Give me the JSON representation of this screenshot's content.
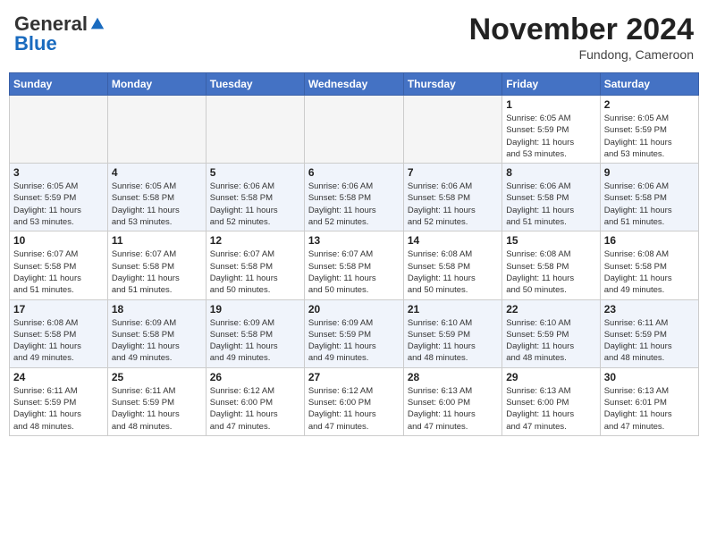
{
  "header": {
    "logo_general": "General",
    "logo_blue": "Blue",
    "month_title": "November 2024",
    "location": "Fundong, Cameroon"
  },
  "weekdays": [
    "Sunday",
    "Monday",
    "Tuesday",
    "Wednesday",
    "Thursday",
    "Friday",
    "Saturday"
  ],
  "weeks": [
    [
      {
        "day": "",
        "info": ""
      },
      {
        "day": "",
        "info": ""
      },
      {
        "day": "",
        "info": ""
      },
      {
        "day": "",
        "info": ""
      },
      {
        "day": "",
        "info": ""
      },
      {
        "day": "1",
        "info": "Sunrise: 6:05 AM\nSunset: 5:59 PM\nDaylight: 11 hours\nand 53 minutes."
      },
      {
        "day": "2",
        "info": "Sunrise: 6:05 AM\nSunset: 5:59 PM\nDaylight: 11 hours\nand 53 minutes."
      }
    ],
    [
      {
        "day": "3",
        "info": "Sunrise: 6:05 AM\nSunset: 5:59 PM\nDaylight: 11 hours\nand 53 minutes."
      },
      {
        "day": "4",
        "info": "Sunrise: 6:05 AM\nSunset: 5:58 PM\nDaylight: 11 hours\nand 53 minutes."
      },
      {
        "day": "5",
        "info": "Sunrise: 6:06 AM\nSunset: 5:58 PM\nDaylight: 11 hours\nand 52 minutes."
      },
      {
        "day": "6",
        "info": "Sunrise: 6:06 AM\nSunset: 5:58 PM\nDaylight: 11 hours\nand 52 minutes."
      },
      {
        "day": "7",
        "info": "Sunrise: 6:06 AM\nSunset: 5:58 PM\nDaylight: 11 hours\nand 52 minutes."
      },
      {
        "day": "8",
        "info": "Sunrise: 6:06 AM\nSunset: 5:58 PM\nDaylight: 11 hours\nand 51 minutes."
      },
      {
        "day": "9",
        "info": "Sunrise: 6:06 AM\nSunset: 5:58 PM\nDaylight: 11 hours\nand 51 minutes."
      }
    ],
    [
      {
        "day": "10",
        "info": "Sunrise: 6:07 AM\nSunset: 5:58 PM\nDaylight: 11 hours\nand 51 minutes."
      },
      {
        "day": "11",
        "info": "Sunrise: 6:07 AM\nSunset: 5:58 PM\nDaylight: 11 hours\nand 51 minutes."
      },
      {
        "day": "12",
        "info": "Sunrise: 6:07 AM\nSunset: 5:58 PM\nDaylight: 11 hours\nand 50 minutes."
      },
      {
        "day": "13",
        "info": "Sunrise: 6:07 AM\nSunset: 5:58 PM\nDaylight: 11 hours\nand 50 minutes."
      },
      {
        "day": "14",
        "info": "Sunrise: 6:08 AM\nSunset: 5:58 PM\nDaylight: 11 hours\nand 50 minutes."
      },
      {
        "day": "15",
        "info": "Sunrise: 6:08 AM\nSunset: 5:58 PM\nDaylight: 11 hours\nand 50 minutes."
      },
      {
        "day": "16",
        "info": "Sunrise: 6:08 AM\nSunset: 5:58 PM\nDaylight: 11 hours\nand 49 minutes."
      }
    ],
    [
      {
        "day": "17",
        "info": "Sunrise: 6:08 AM\nSunset: 5:58 PM\nDaylight: 11 hours\nand 49 minutes."
      },
      {
        "day": "18",
        "info": "Sunrise: 6:09 AM\nSunset: 5:58 PM\nDaylight: 11 hours\nand 49 minutes."
      },
      {
        "day": "19",
        "info": "Sunrise: 6:09 AM\nSunset: 5:58 PM\nDaylight: 11 hours\nand 49 minutes."
      },
      {
        "day": "20",
        "info": "Sunrise: 6:09 AM\nSunset: 5:59 PM\nDaylight: 11 hours\nand 49 minutes."
      },
      {
        "day": "21",
        "info": "Sunrise: 6:10 AM\nSunset: 5:59 PM\nDaylight: 11 hours\nand 48 minutes."
      },
      {
        "day": "22",
        "info": "Sunrise: 6:10 AM\nSunset: 5:59 PM\nDaylight: 11 hours\nand 48 minutes."
      },
      {
        "day": "23",
        "info": "Sunrise: 6:11 AM\nSunset: 5:59 PM\nDaylight: 11 hours\nand 48 minutes."
      }
    ],
    [
      {
        "day": "24",
        "info": "Sunrise: 6:11 AM\nSunset: 5:59 PM\nDaylight: 11 hours\nand 48 minutes."
      },
      {
        "day": "25",
        "info": "Sunrise: 6:11 AM\nSunset: 5:59 PM\nDaylight: 11 hours\nand 48 minutes."
      },
      {
        "day": "26",
        "info": "Sunrise: 6:12 AM\nSunset: 6:00 PM\nDaylight: 11 hours\nand 47 minutes."
      },
      {
        "day": "27",
        "info": "Sunrise: 6:12 AM\nSunset: 6:00 PM\nDaylight: 11 hours\nand 47 minutes."
      },
      {
        "day": "28",
        "info": "Sunrise: 6:13 AM\nSunset: 6:00 PM\nDaylight: 11 hours\nand 47 minutes."
      },
      {
        "day": "29",
        "info": "Sunrise: 6:13 AM\nSunset: 6:00 PM\nDaylight: 11 hours\nand 47 minutes."
      },
      {
        "day": "30",
        "info": "Sunrise: 6:13 AM\nSunset: 6:01 PM\nDaylight: 11 hours\nand 47 minutes."
      }
    ]
  ]
}
